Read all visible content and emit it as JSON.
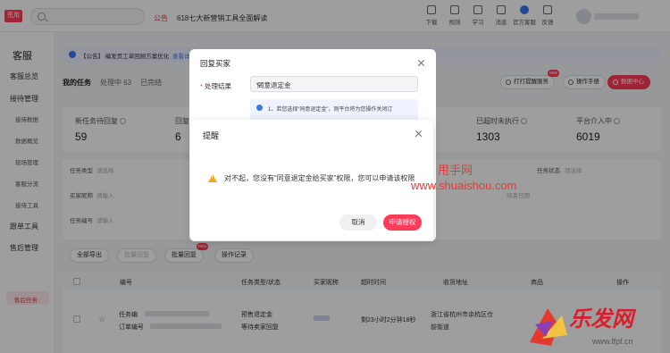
{
  "topbar": {
    "badge": "荒用",
    "notice_tag": "公告",
    "notice_text": "618七大新营销工具全面解读",
    "tools": [
      {
        "label": "下载",
        "icon": "download-icon"
      },
      {
        "label": "规则",
        "icon": "rule-icon"
      },
      {
        "label": "学习",
        "icon": "learn-icon"
      },
      {
        "label": "消息",
        "icon": "message-icon"
      },
      {
        "label": "官方客服",
        "icon": "service-icon"
      },
      {
        "label": "反馈",
        "icon": "feedback-icon"
      }
    ]
  },
  "sidebar": {
    "title": "客服",
    "items": [
      "客服总览",
      "接待管理",
      "接待数据",
      "数据概览",
      "现场管理",
      "客服分流",
      "接待工具",
      "跟单工具",
      "售后管理",
      "售后任务"
    ]
  },
  "main": {
    "announcement": "【公告】 编发页工单回顾方案优化",
    "announcement_link": "查看详情",
    "tabs": [
      "我的任务",
      "处理中 63",
      "已完结"
    ],
    "right_buttons": [
      "打打提醒服务",
      "操作手册",
      "数据中心"
    ],
    "new_badge": "new",
    "stats": [
      {
        "label": "新任务待回复",
        "value": "59"
      },
      {
        "label": "回复",
        "value": "6"
      },
      {
        "label": "已超时未执行",
        "value": "1303"
      },
      {
        "label": "平台介入中",
        "value": "6019"
      }
    ],
    "filters": {
      "task_type_label": "任务类型",
      "task_type_ph": "请选择",
      "task_status_label": "任务状态",
      "task_status_ph": "请选择",
      "buyer_label": "买家昵称",
      "buyer_ph": "请输入",
      "end_time_ph": "结束日期",
      "task_no_label": "任务编号",
      "task_no_ph": "请输入"
    },
    "actions": [
      "全部导出",
      "批量回复",
      "批量回复",
      "操作记录"
    ],
    "table": {
      "headers": [
        "编号",
        "任务类型/状态",
        "买家昵称",
        "超时时间",
        "收货地址",
        "商品",
        "操作"
      ],
      "row": {
        "task_prefix": "任务编",
        "order_prefix": "订单编号",
        "type": "预售退定金",
        "status": "等待卖家回复",
        "timeout": "剩23小时2分钟18秒",
        "address1": "浙江省杭州市余杭区仓",
        "address2": "前街道"
      }
    }
  },
  "dialog_reply": {
    "title": "回复买家",
    "field_label": "处理结果",
    "required_mark": "*",
    "selected_value": "同意退定金",
    "info_text": "1、若您选择“同意退定金”，则平台将为您操作关闭订"
  },
  "dialog_alert": {
    "title": "提醒",
    "message": "对不起，您没有“同意退定金给买家”权限，您可以申请该权限",
    "cancel": "取消",
    "apply": "申请授权"
  },
  "watermarks": {
    "line1": "甩手网",
    "line2": "www.shuaishou.com",
    "logo_text": "乐发网",
    "logo_url": "www.lfpf.cn"
  },
  "colors": {
    "accent": "#ff3b57",
    "link": "#3a78f2",
    "warning": "#f5a623"
  }
}
